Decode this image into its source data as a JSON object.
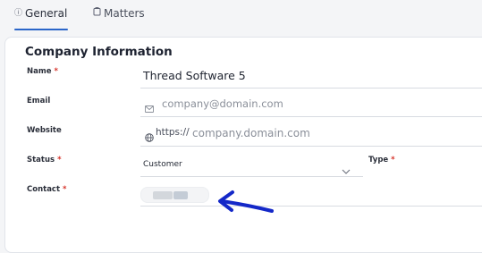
{
  "tabs": [
    {
      "label": "General",
      "icon": "info-circle-icon",
      "active": true
    },
    {
      "label": "Matters",
      "icon": "briefcase-icon",
      "active": false
    }
  ],
  "section": {
    "title": "Company Information"
  },
  "fields": {
    "name": {
      "label": "Name",
      "required_mark": "*",
      "value": "Thread Software 5"
    },
    "email": {
      "label": "Email",
      "placeholder": "company@domain.com",
      "icon": "mail-icon"
    },
    "website": {
      "label": "Website",
      "prefix": "https://",
      "placeholder": "company.domain.com",
      "icon": "globe-icon"
    },
    "status": {
      "label": "Status",
      "required_mark": "*",
      "value": "Customer"
    },
    "type": {
      "label": "Type",
      "required_mark": "*"
    },
    "contact": {
      "label": "Contact",
      "required_mark": "*"
    }
  },
  "colors": {
    "accent": "#2b66c9",
    "required": "#d6332a",
    "annotation_arrow": "#1428c8"
  }
}
